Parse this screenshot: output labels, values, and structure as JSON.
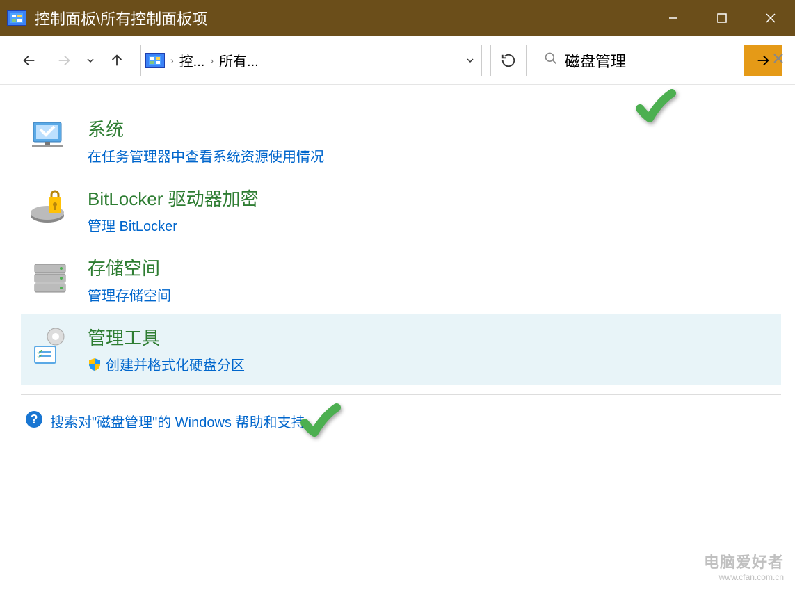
{
  "window": {
    "title": "控制面板\\所有控制面板项"
  },
  "breadcrumb": {
    "item1": "控...",
    "item2": "所有..."
  },
  "search": {
    "value": "磁盘管理"
  },
  "categories": [
    {
      "title": "系统",
      "link": "在任务管理器中查看系统资源使用情况"
    },
    {
      "title": "BitLocker 驱动器加密",
      "link": "管理 BitLocker"
    },
    {
      "title": "存储空间",
      "link": "管理存储空间"
    },
    {
      "title": "管理工具",
      "link": "创建并格式化硬盘分区"
    }
  ],
  "help": {
    "text": "搜索对\"磁盘管理\"的 Windows 帮助和支持"
  },
  "watermark": {
    "line1": "电脑爱好者",
    "line2": "www.cfan.com.cn"
  }
}
